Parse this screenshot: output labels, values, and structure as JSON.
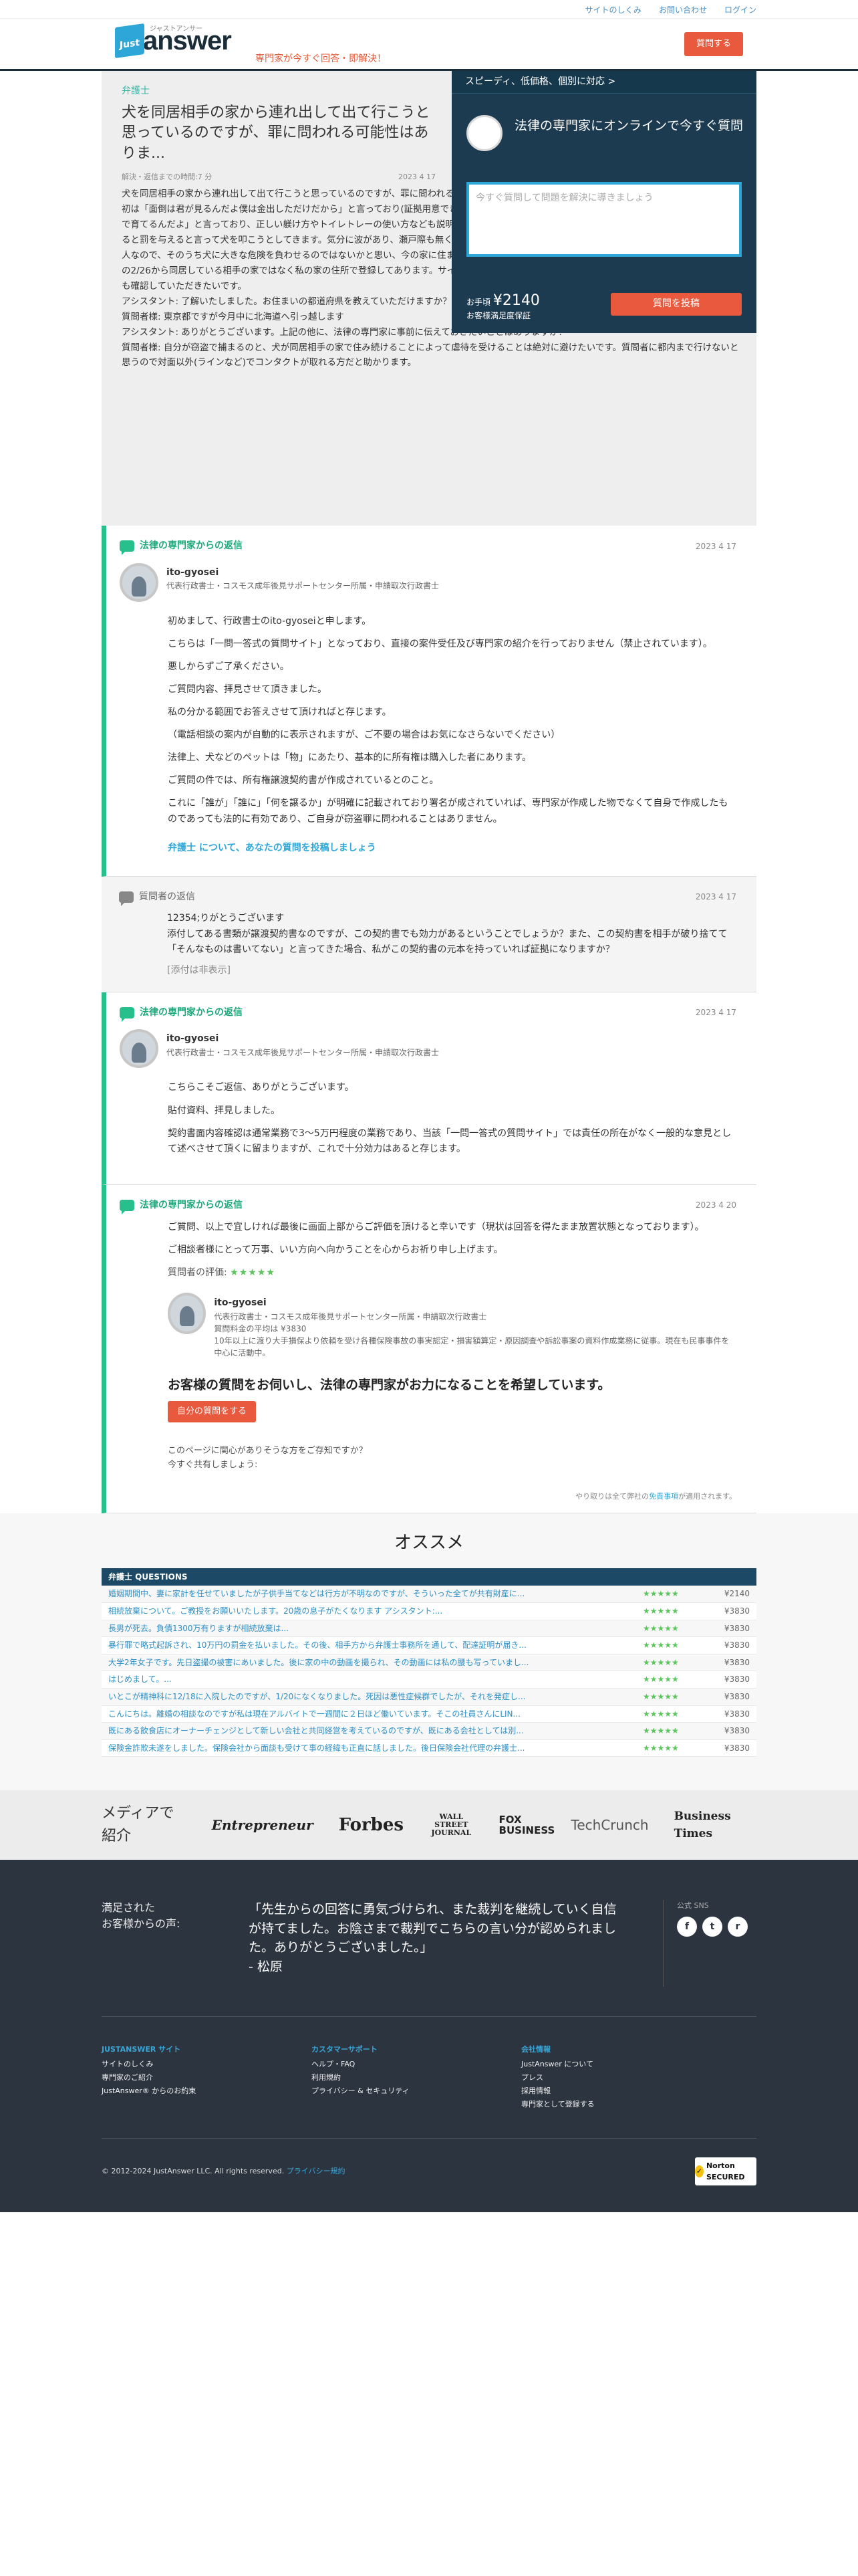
{
  "topnav": [
    "サイトのしくみ",
    "お問い合わせ",
    "ログイン"
  ],
  "header": {
    "logo_badge": "Just",
    "logo_word": "answer",
    "logo_kana": "ジャストアンサー",
    "tagline": "専門家が今すぐ回答・即解決！",
    "button": "質問する"
  },
  "question": {
    "category": "弁護士",
    "title": "犬を同居相手の家から連れ出して出て行こうと思っているのですが、罪に問われる可能性はありま...",
    "meta_left": "解決・返信までの時間:7 分",
    "meta_right": "2023 4 17",
    "body": [
      "犬を同居相手の家から連れ出して出て行こうと思っているのですが、罪に問われる可能性はありますか？犬の購入者である同居相手は気分に波があり、最初は「面倒は君が見るんだよ僕は金出しただけだから」と言っており(証拠用意できてます)所有権譲渡契約書にサインをしてもらいましたが、現在は「2人で育てるんだよ」と言っており、正しい躾け方やトイレトレーの使い方なども説明すると「一回で覚えられるわけないだろ」と逆ギレしたり、犬が夜吠えると罰を与えると言って犬を叩こうとしてきます。気分に波があり、瀬戸際も無く、「そんなこと言ったっけ？」「知らない」で全て押し通せると思ってる人なので、そのうち犬に大きな危険を負わせるのではないかと思い、今の家に住まわせておくのは危険だと判断しました。マイクロチップの登録は購入日の2/26から同居している相手の家ではなく私の家の住所で登録してあります。サインしてもらった所有権譲渡契約書にどの程度の法的効力があるかどうかも確認していただきたいです。",
      "アシスタント: 了解いたしました。お住まいの都道府県を教えていただけますか？",
      "質問者様: 東京都ですが今月中に北海道へ引っ越します",
      "アシスタント: ありがとうございます。上記の他に、法律の専門家に事前に伝えておきたいことはありますか？",
      "質問者様: 自分が窃盗で捕まるのと、犬が同居相手の家で住み続けることによって虐待を受けることは絶対に避けたいです。質問者に都内まで行けないと思うので対面以外(ラインなど)でコンタクトが取れる方だと助かります。"
    ]
  },
  "side": {
    "top": "スピーディ、低価格、個別に対応 >",
    "title": "法律の専門家にオンラインで今すぐ質問",
    "placeholder": "今すぐ質問して問題を解決に導きましょう",
    "price_small": "お手頃",
    "price": "¥2140",
    "guarantee": "お客様満足度保証",
    "button": "質問を投稿"
  },
  "answer1": {
    "label": "法律の専門家からの返信",
    "date": "2023 4 17",
    "name": "ito-gyosei",
    "title": "代表行政書士・コスモス成年後見サポートセンター所属・申請取次行政書士",
    "body": [
      "初めまして、行政書士のito-gyoseiと申します。",
      "こちらは「一問一答式の質問サイト」となっており、直接の案件受任及び専門家の紹介を行っておりません（禁止されています）。",
      "悪しからずご了承ください。",
      "ご質問内容、拝見させて頂きました。",
      "私の分かる範囲でお答えさせて頂ければと存じます。",
      "（電話相談の案内が自動的に表示されますが、ご不要の場合はお気になさらないでください）",
      "法律上、犬などのペットは「物」にあたり、基本的に所有権は購入した者にあります。",
      "ご質問の件では、所有権譲渡契約書が作成されているとのこと。",
      "これに「誰が」「誰に」「何を譲るか」が明確に記載されており署名が成されていれば、専門家が作成した物でなくて自身で作成したものであっても法的に有効であり、ご自身が窃盗罪に問われることはありません。"
    ],
    "cta": "弁護士 について、あなたの質問を投稿しましょう"
  },
  "reply": {
    "label": "質問者の返信",
    "date": "2023 4 17",
    "body": [
      "12354;りがとうございます",
      "添付してある書類が譲渡契約書なのですが、この契約書でも効力があるということでしょうか？また、この契約書を相手が破り捨てて「そんなものは書いてない」と言ってきた場合、私がこの契約書の元本を持っていれば証拠になりますか？"
    ],
    "attach": "[添付は非表示]"
  },
  "answer2": {
    "label": "法律の専門家からの返信",
    "date": "2023 4 17",
    "name": "ito-gyosei",
    "title": "代表行政書士・コスモス成年後見サポートセンター所属・申請取次行政書士",
    "body": [
      "こちらこそご返信、ありがとうございます。",
      "貼付資料、拝見しました。",
      "契約書面内容確認は通常業務で3〜5万円程度の業務であり、当該「一問一答式の質問サイト」では責任の所在がなく一般的な意見として述べさせて頂くに留まりますが、これで十分効力はあると存じます。"
    ]
  },
  "answer3": {
    "label": "法律の専門家からの返信",
    "date": "2023 4 20",
    "body": [
      "ご質問、以上で宜しければ最後に画面上部からご評価を頂けると幸いです（現状は回答を得たまま放置状態となっております）。",
      "ご相談者様にとって万事、いい方向へ向かうことを心からお祈り申し上げます。"
    ],
    "rating_label": "質問者の評価:",
    "rating_stars": "★★★★★",
    "card_name": "ito-gyosei",
    "card_lines": [
      "代表行政書士・コスモス成年後見サポートセンター所属・申請取次行政書士",
      "質問料金の平均は ¥3830",
      "10年以上に渡り大手損保より依頼を受け各種保険事故の事実認定・損害額算定・原因調査や訴訟事案の資料作成業務に従事。現在も民事事件を中心に活動中。"
    ],
    "hope": "お客様の質問をお伺いし、法律の専門家がお力になることを希望しています。",
    "button": "自分の質問をする",
    "share1": "このページに関心がありそうな方をご存知ですか？",
    "share2": "今すぐ共有しましょう:",
    "note_prefix": "やり取りは全て弊社の",
    "note_link": "免責事項",
    "note_suffix": "が適用されます。"
  },
  "reco": {
    "title": "オススメ",
    "head": "弁護士 QUESTIONS",
    "rows": [
      {
        "q": "婚姻期間中、妻に家計を任せていましたが子供手当てなどは行方が不明なのですが、そういった全てが共有財産に...",
        "s": "★★★★★",
        "p": "¥2140"
      },
      {
        "q": "相続放棄について。ご教授をお願いいたします。20歳の息子がたくなります アシスタント:...",
        "s": "★★★★★",
        "p": "¥3830"
      },
      {
        "q": "長男が死去。負債1300万有りますが相続放棄は...",
        "s": "★★★★★",
        "p": "¥3830"
      },
      {
        "q": "暴行罪で略式起訴され、10万円の罰金を払いました。その後、相手方から弁護士事務所を通して、配達証明が届き...",
        "s": "★★★★★",
        "p": "¥3830"
      },
      {
        "q": "大学2年女子です。先日盗撮の被害にあいました。後に家の中の動画を撮られ、その動画には私の腰も写っていまし...",
        "s": "★★★★★",
        "p": "¥3830"
      },
      {
        "q": "はじめまして。...",
        "s": "★★★★★",
        "p": "¥3830"
      },
      {
        "q": "いとこが精神科に12/18に入院したのですが、1/20になくなりました。死因は悪性症候群でしたが、それを発症し...",
        "s": "★★★★★",
        "p": "¥3830"
      },
      {
        "q": "こんにちは。離婚の相談なのですが私は現在アルバイトで一週間に２日ほど働いています。そこの社員さんにLIN...",
        "s": "★★★★★",
        "p": "¥3830"
      },
      {
        "q": "既にある飲食店にオーナーチェンジとして新しい会社と共同経営を考えているのですが、既にある会社としては別...",
        "s": "★★★★★",
        "p": "¥3830"
      },
      {
        "q": "保険金詐欺未遂をしました。保険会社から面談も受けて事の経緯も正直に話しました。後日保険会社代理の弁護士...",
        "s": "★★★★★",
        "p": "¥3830"
      }
    ]
  },
  "media": {
    "label": "メディアで紹介",
    "logos": [
      "Entrepreneur",
      "Forbes",
      "WALL STREET JOURNAL",
      "FOX BUSINESS",
      "TechCrunch",
      "Business Times"
    ]
  },
  "footer": {
    "sat_label": "満足された\nお客様からの声:",
    "quote": "「先生からの回答に勇気づけられ、また裁判を継続していく自信が持てました。お陰さまで裁判でこちらの言い分が認められました。ありがとうございました。」\n- 松原",
    "sns_label": "公式 SNS",
    "sns": [
      "f",
      "t",
      "r"
    ],
    "cols": [
      {
        "h": "JUSTANSWER サイト",
        "items": [
          "サイトのしくみ",
          "専門家のご紹介",
          "JustAnswer® からのお約束"
        ]
      },
      {
        "h": "カスタマーサポート",
        "items": [
          "ヘルプ・FAQ",
          "利用規約",
          "プライバシー & セキュリティ"
        ]
      },
      {
        "h": "会社情報",
        "items": [
          "JustAnswer について",
          "プレス",
          "採用情報",
          "専門家として登録する"
        ]
      }
    ],
    "copyright": "© 2012-2024 JustAnswer LLC. All rights reserved.",
    "privacy": "プライバシー規約",
    "norton": "Norton SECURED"
  }
}
